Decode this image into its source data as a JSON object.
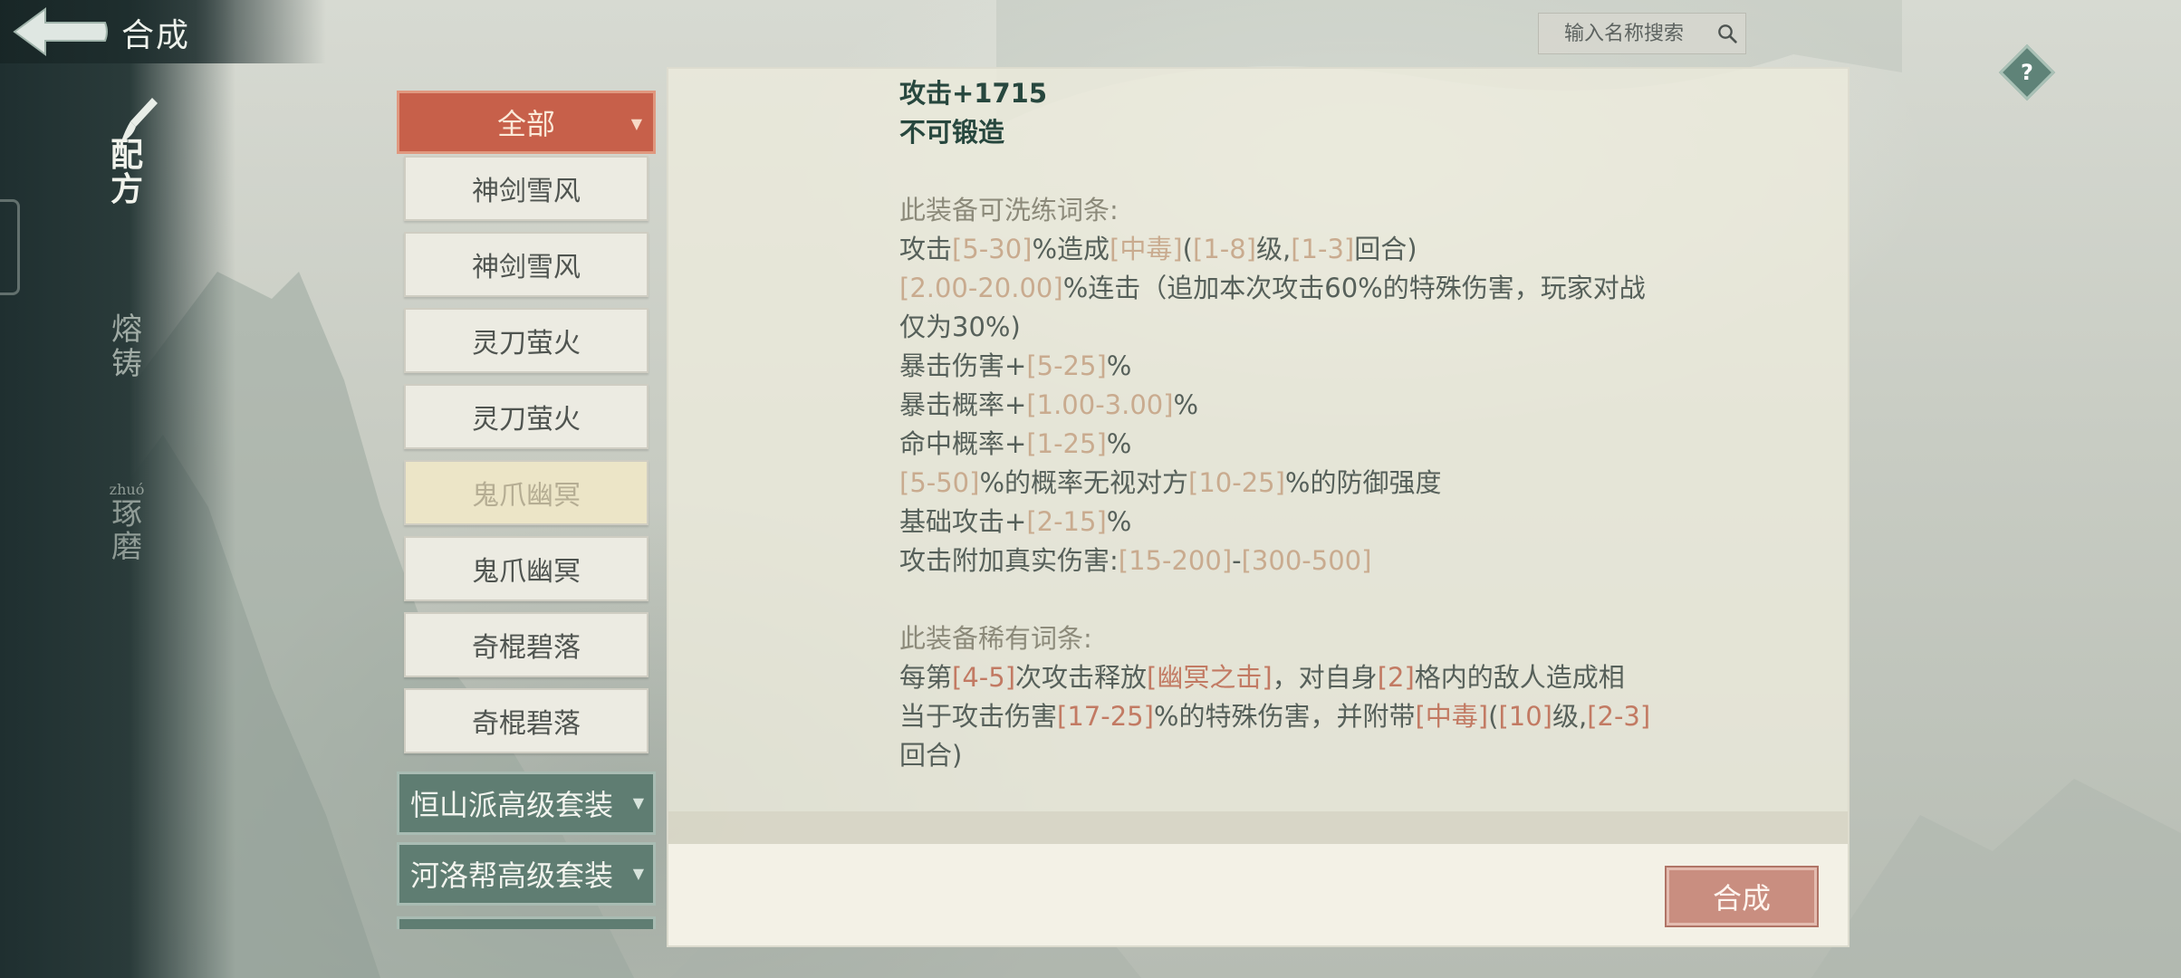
{
  "header": {
    "title": "合成"
  },
  "side_tabs": [
    {
      "label_chars": [
        "配",
        "方"
      ],
      "active": true
    },
    {
      "label_chars": [
        "熔",
        "铸"
      ],
      "active": false
    },
    {
      "label_small": "zhuó",
      "label_chars": [
        "琢",
        "磨"
      ],
      "active": false
    }
  ],
  "search": {
    "placeholder": "输入名称搜索"
  },
  "help": {
    "label": "?"
  },
  "list": {
    "category_all": "全部",
    "items": [
      "神剑雪风",
      "神剑雪风",
      "灵刀萤火",
      "灵刀萤火",
      "鬼爪幽冥",
      "鬼爪幽冥",
      "奇棍碧落",
      "奇棍碧落"
    ],
    "selected_index": 4,
    "categories": [
      "恒山派高级套装",
      "河洛帮高级套装"
    ]
  },
  "details": {
    "attack": "攻击+1715",
    "forge": "不可锻造",
    "wash_title": "此装备可洗练词条:",
    "wash_lines": [
      "攻击[5-30]%造成[中毒]([1-8]级,[1-3]回合)",
      "[2.00-20.00]%连击（追加本次攻击60%的特殊伤害，玩家对战",
      "仅为30%)",
      "暴击伤害+[5-25]%",
      "暴击概率+[1.00-3.00]%",
      "命中概率+[1-25]%",
      "[5-50]%的概率无视对方[10-25]%的防御强度",
      "基础攻击+[2-15]%",
      "攻击附加真实伤害:[15-200]-[300-500]"
    ],
    "rare_title": "此装备稀有词条:",
    "rare_lines": [
      "每第[4-5]次攻击释放[幽冥之击]，对自身[2]格内的敌人造成相",
      "当于攻击伤害[17-25]%的特殊伤害，并附带[中毒]([10]级,[2-3]",
      "回合)"
    ]
  },
  "footer": {
    "synth_button": "合成"
  },
  "colors": {
    "accent_red": "#c7604a",
    "category_green": "#5f7d72",
    "highlight_orange": "#c27a63",
    "text_dark_green": "#27473e"
  }
}
